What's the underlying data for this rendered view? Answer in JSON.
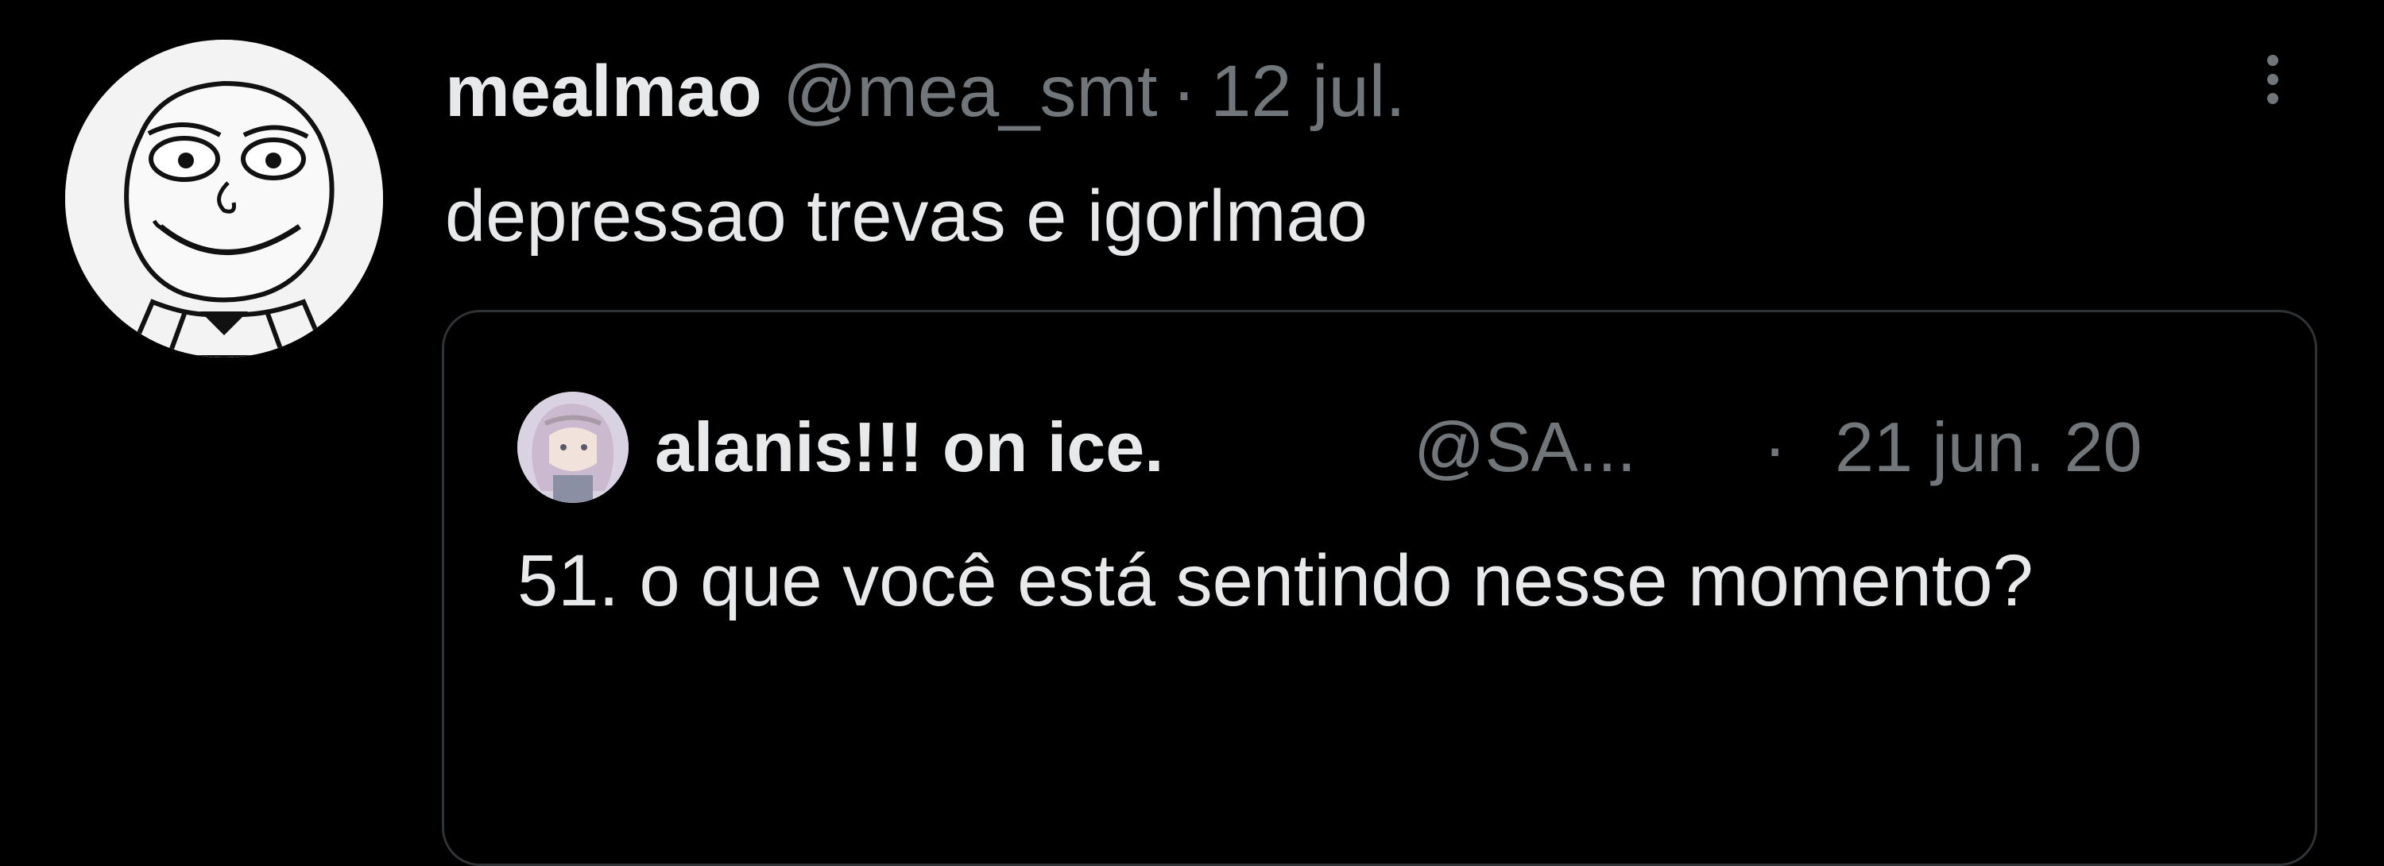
{
  "tweet": {
    "display_name": "mealmao",
    "handle": "@mea_smt",
    "separator": "·",
    "date": "12 jul.",
    "text": "depressao trevas e igorlmao",
    "avatar_icon": "rage-comic-face-avatar",
    "more_icon": "more-options-icon"
  },
  "quoted_tweet": {
    "display_name": "alanis!!! on ice.",
    "handle": "@SA...",
    "separator": "·",
    "date": "21 jun. 20",
    "text": "51. o que você está sentindo nesse momento?",
    "avatar_icon": "anime-character-avatar"
  },
  "colors": {
    "background": "#000000",
    "primary_text": "#e7e9ea",
    "secondary_text": "#71767b",
    "border": "#2f3336"
  }
}
